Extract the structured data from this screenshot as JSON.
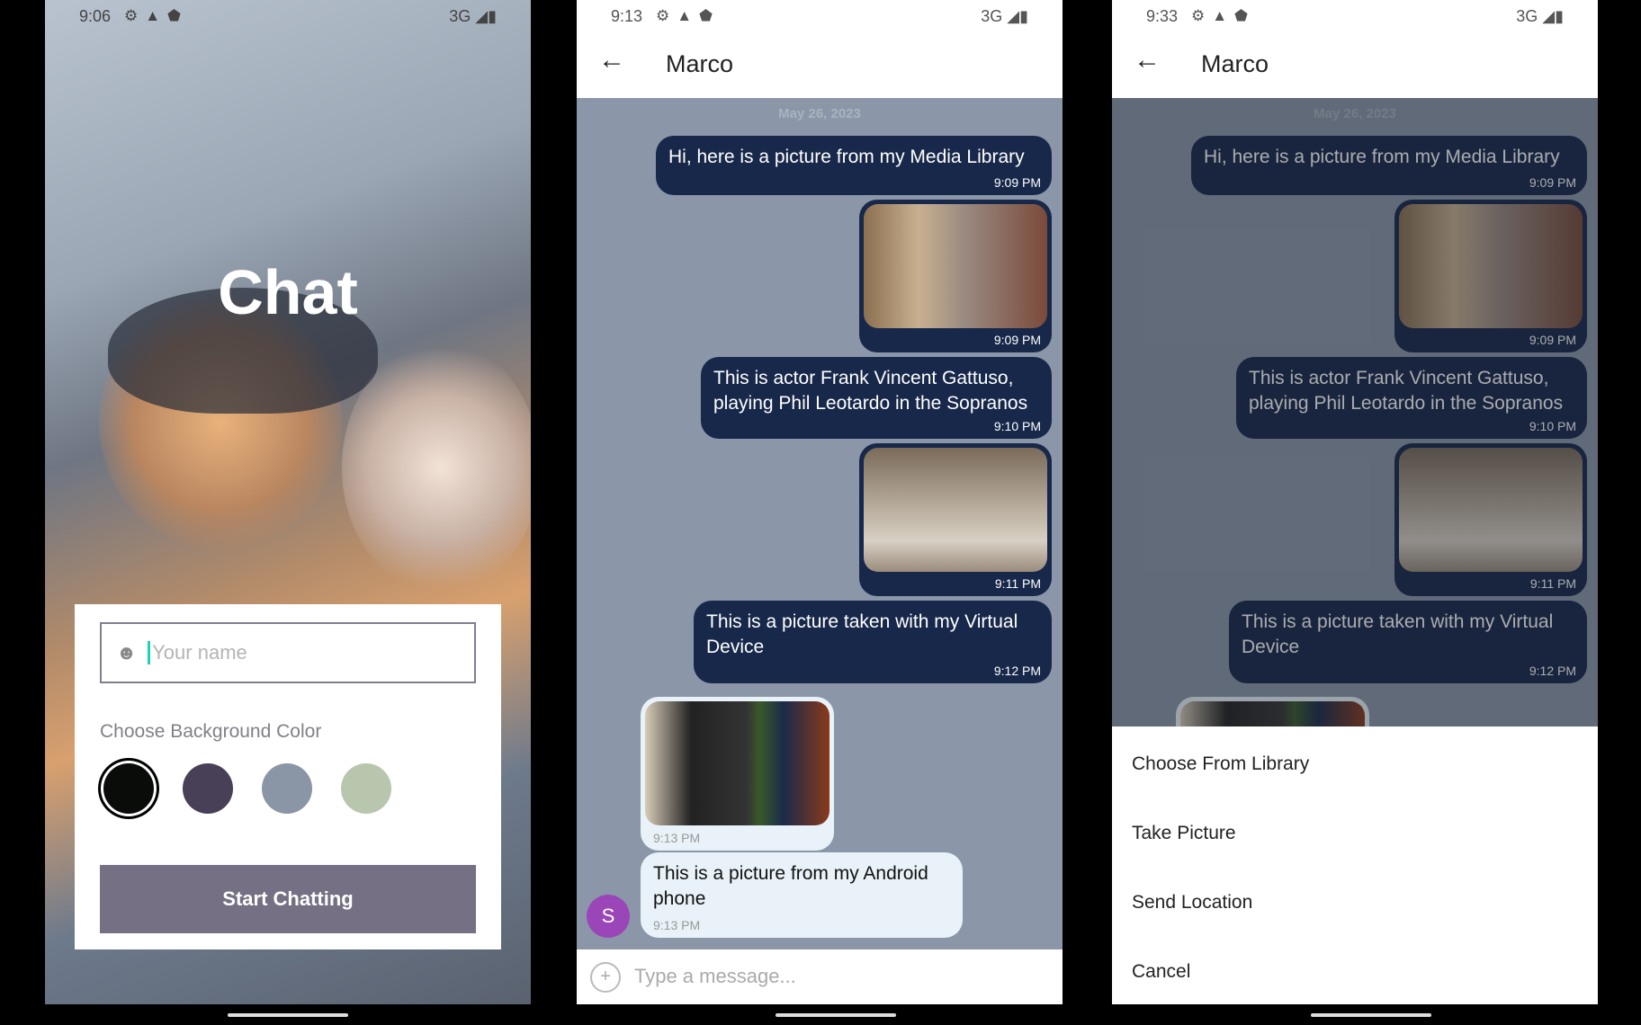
{
  "screens": {
    "welcome": {
      "status": {
        "time": "9:06",
        "network": "3G"
      },
      "title": "Chat",
      "name_placeholder": "Your name",
      "bg_label": "Choose Background Color",
      "swatches": [
        "#090C08",
        "#474056",
        "#8A95A5",
        "#B9C6AE"
      ],
      "selected_swatch": 0,
      "start_button": "Start Chatting",
      "button_color": "#757083"
    },
    "chat": {
      "status": {
        "time": "9:13",
        "network": "3G"
      },
      "back_icon": "arrow-left-icon",
      "title": "Marco"
    },
    "actions": {
      "status": {
        "time": "9:33",
        "network": "3G"
      },
      "title": "Marco",
      "options": [
        "Choose From Library",
        "Take Picture",
        "Send Location",
        "Cancel"
      ]
    }
  },
  "conversation": {
    "date": "May 26, 2023",
    "messages": [
      {
        "side": "right",
        "text": "Hi, here is a picture from my Media Library",
        "time": "9:09 PM"
      },
      {
        "side": "right",
        "image": "man-pointing-photo",
        "time": "9:09 PM"
      },
      {
        "side": "right",
        "text": "This is actor Frank Vincent Gattuso, playing Phil Leotardo in the Sopranos",
        "time": "9:10 PM"
      },
      {
        "side": "right",
        "image": "sofa-photo",
        "time": "9:11 PM"
      },
      {
        "side": "right",
        "text": "This is a picture taken with my Virtual Device",
        "time": "9:12 PM"
      },
      {
        "side": "left",
        "image": "living-room-tv-photo",
        "time": "9:13 PM"
      },
      {
        "side": "left",
        "text": "This is a picture from my Android phone",
        "time": "9:13 PM"
      }
    ],
    "avatar_initial": "S",
    "input_placeholder": "Type a message..."
  }
}
